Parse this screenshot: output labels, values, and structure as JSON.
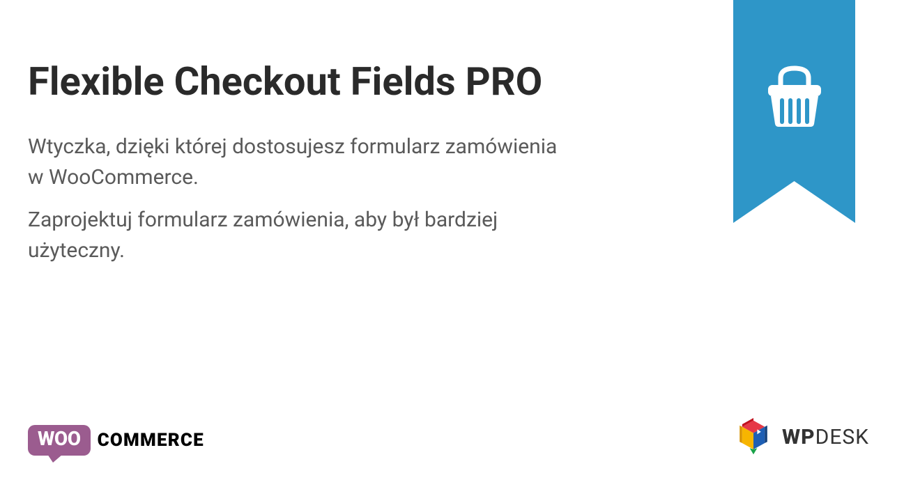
{
  "title": "Flexible Checkout Fields PRO",
  "description": {
    "line1": "Wtyczka, dzięki której dostosujesz formularz zamówienia w WooCommerce.",
    "line2": "Zaprojektuj formularz zamówienia, aby był bardziej użyteczny."
  },
  "ribbon": {
    "color": "#2e96c8",
    "icon": "basket-icon"
  },
  "logos": {
    "woocommerce": {
      "bubble_text": "WOO",
      "suffix_text": "COMMERCE",
      "bubble_color": "#9b5c8f"
    },
    "wpdesk": {
      "prefix": "WP",
      "suffix": "DESK"
    }
  }
}
